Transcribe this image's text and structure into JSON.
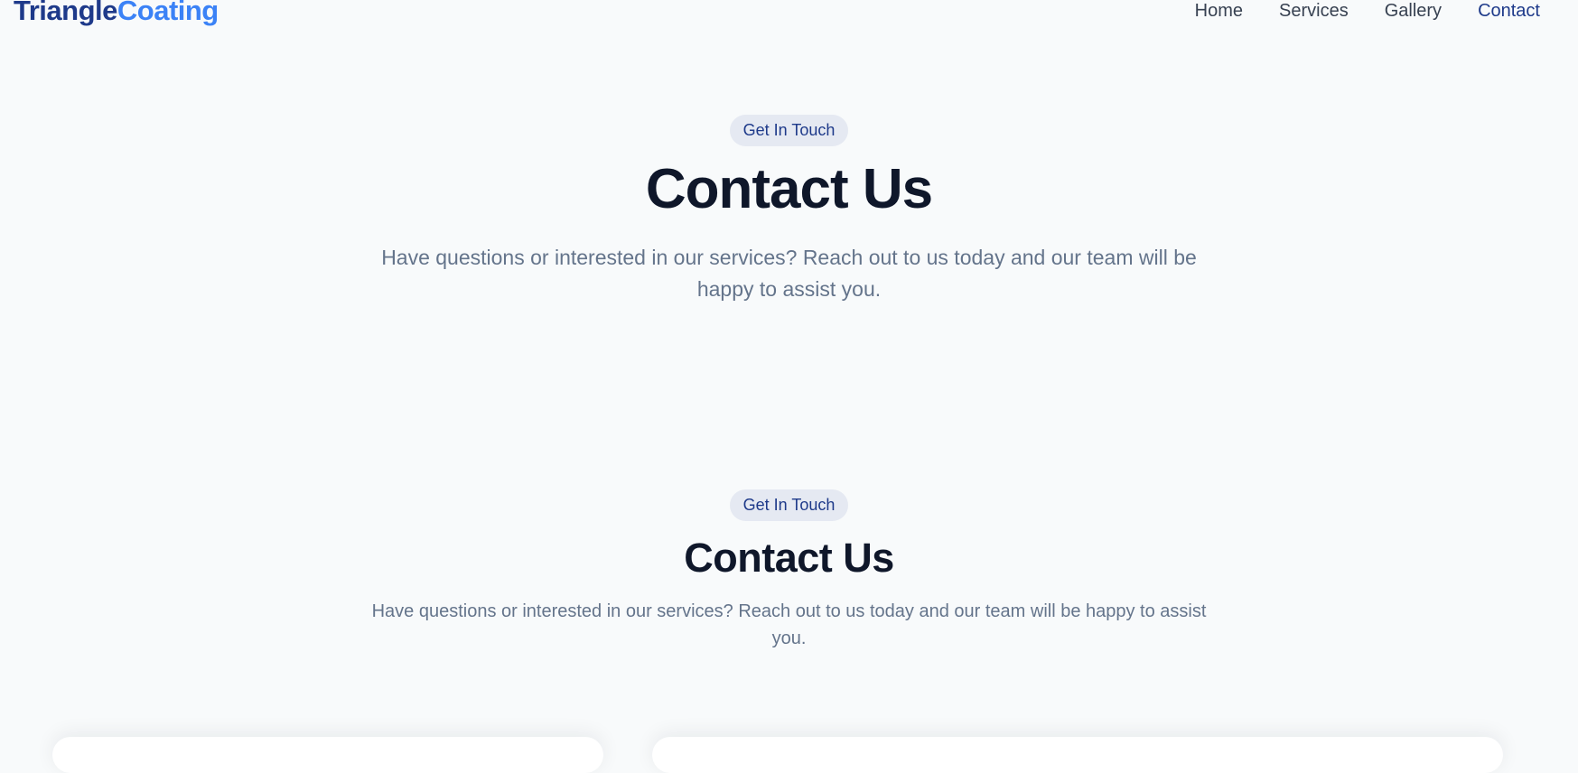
{
  "brand": {
    "name_part1": "Triangle",
    "name_part2": "Coating",
    "primary_color": "#1e3a8a",
    "accent_color": "#3b82f6"
  },
  "nav": {
    "items": [
      {
        "label": "Home"
      },
      {
        "label": "Services"
      },
      {
        "label": "Gallery"
      },
      {
        "label": "Contact",
        "active": true
      }
    ]
  },
  "hero": {
    "badge": "Get In Touch",
    "title": "Contact Us",
    "description": "Have questions or interested in our services? Reach out to us today and our team will be happy to assist you."
  },
  "contact_section": {
    "badge": "Get In Touch",
    "title": "Contact Us",
    "description": "Have questions or interested in our services? Reach out to us today and our team will be happy to assist you."
  }
}
